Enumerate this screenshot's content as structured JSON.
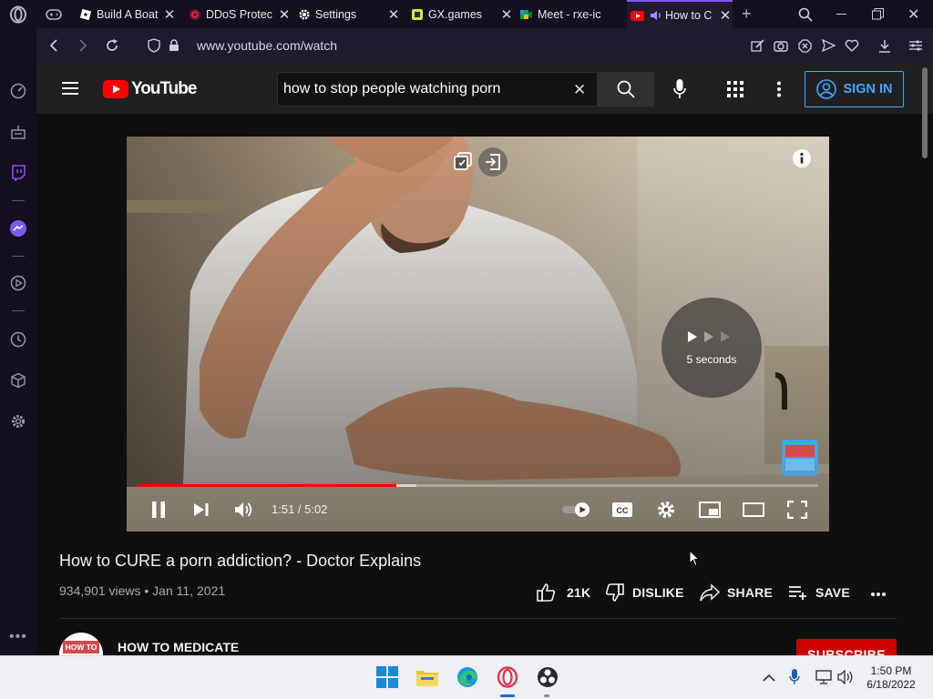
{
  "browser": {
    "tabs": [
      {
        "title": "Build A Boat",
        "icon": "roblox-icon"
      },
      {
        "title": "DDoS Protec",
        "icon": "ddos-guard-icon"
      },
      {
        "title": "Settings",
        "icon": "gear-icon"
      },
      {
        "title": "GX.games",
        "icon": "gxgames-icon"
      },
      {
        "title": "Meet - rxe-ic",
        "icon": "google-meet-icon"
      },
      {
        "title": "How to C",
        "icon": "youtube-icon",
        "active": true,
        "audio": true
      }
    ],
    "url": "www.youtube.com/watch"
  },
  "youtube": {
    "logo_text": "YouTube",
    "search": {
      "value": "how to stop people watching porn",
      "placeholder": "Search"
    },
    "signin_label": "SIGN IN",
    "player": {
      "elapsed": "1:51",
      "duration": "5:02",
      "time_display": "1:51 / 5:02",
      "progress": 0.38,
      "buffered": 0.41,
      "seek_overlay": "5 seconds",
      "watermark": "HOW TO MEDICATE"
    },
    "video": {
      "title": "How to CURE a porn addiction? - Doctor Explains",
      "views": "934,901 views",
      "date": "Jan 11, 2021",
      "meta_line": "934,901 views • Jan 11, 2021",
      "likes": "21K",
      "dislike_label": "DISLIKE",
      "share_label": "SHARE",
      "save_label": "SAVE"
    },
    "channel": {
      "name": "HOW TO MEDICATE",
      "avatar_text": "HOW TO",
      "subscribe_label": "SUBSCRIBE"
    }
  },
  "taskbar": {
    "time": "1:50 PM",
    "date": "6/18/2022",
    "apps": [
      "windows-start-icon",
      "file-explorer-icon",
      "edge-icon",
      "opera-gx-icon",
      "obs-icon"
    ]
  },
  "colors": {
    "accent": "#7f5bf2",
    "youtube_red": "#ff0000",
    "link_blue": "#3ea6ff",
    "subscribe_red": "#cc0000"
  }
}
